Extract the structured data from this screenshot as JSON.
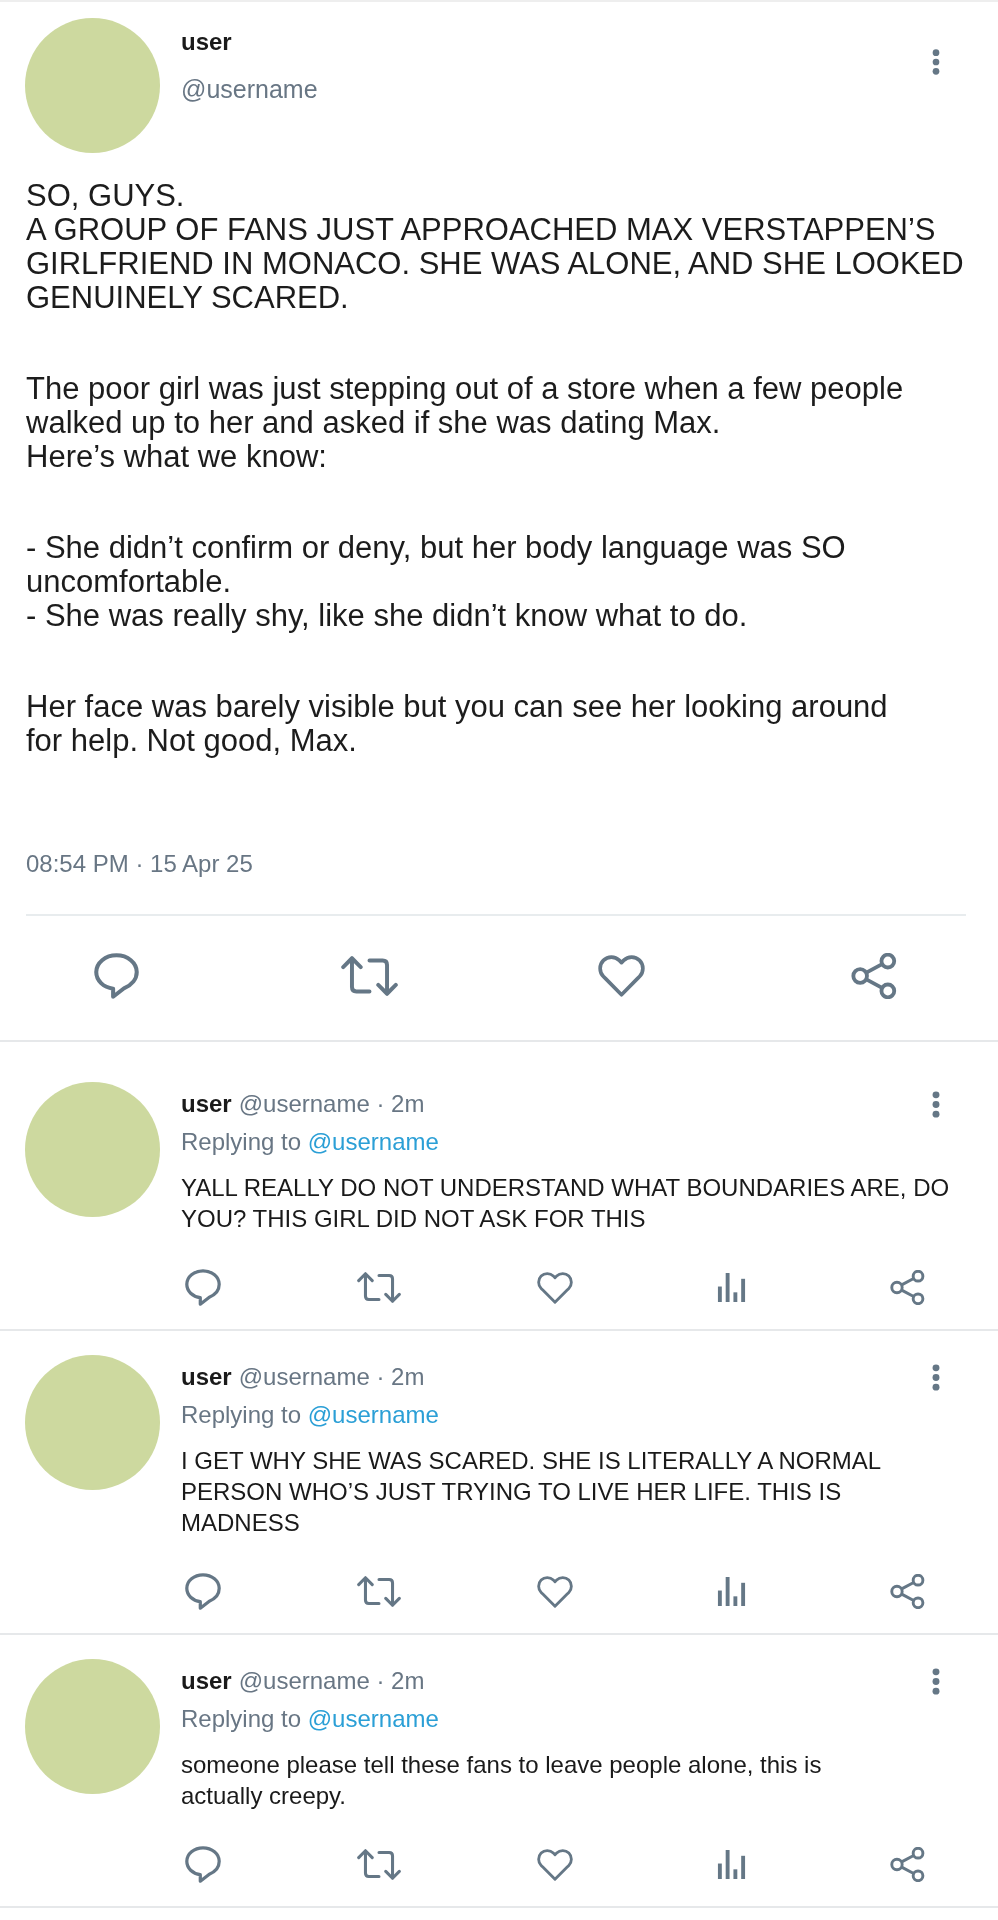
{
  "post": {
    "author": {
      "name": "user",
      "handle": "@username"
    },
    "paragraphs": [
      "SO, GUYS.\nA GROUP OF FANS JUST APPROACHED MAX VERSTAPPEN’S\nGIRLFRIEND IN MONACO. SHE WAS ALONE, AND SHE LOOKED\nGENUINELY SCARED.",
      "The poor girl was just stepping out of a store when a few people\nwalked up to her and asked if she was dating Max.\nHere’s what we know:",
      "- She didn’t confirm or deny, but her body language was SO\nuncomfortable.\n- She was really shy, like she didn’t know what to do.",
      "Her face was barely visible but you can see her looking around\nfor help. Not good, Max."
    ],
    "timestamp": "08:54 PM · 15 Apr 25",
    "actions": [
      {
        "kind": "comment"
      },
      {
        "kind": "repost"
      },
      {
        "kind": "like"
      },
      {
        "kind": "share"
      }
    ]
  },
  "replies": [
    {
      "name": "user",
      "byline": "@username · 2m",
      "replying_label": "Replying to",
      "replying_to": "@username",
      "text": "YALL REALLY DO NOT UNDERSTAND WHAT BOUNDARIES ARE, DO\nYOU? THIS GIRL DID NOT ASK FOR THIS",
      "actions": [
        {
          "kind": "comment"
        },
        {
          "kind": "repost"
        },
        {
          "kind": "like"
        },
        {
          "kind": "stats"
        },
        {
          "kind": "share"
        }
      ]
    },
    {
      "name": "user",
      "byline": "@username · 2m",
      "replying_label": "Replying to",
      "replying_to": "@username",
      "text": "I GET WHY SHE WAS SCARED. SHE IS LITERALLY A NORMAL\nPERSON WHO’S JUST TRYING TO LIVE HER LIFE. THIS IS\nMADNESS",
      "actions": [
        {
          "kind": "comment"
        },
        {
          "kind": "repost"
        },
        {
          "kind": "like"
        },
        {
          "kind": "stats"
        },
        {
          "kind": "share"
        }
      ]
    },
    {
      "name": "user",
      "byline": "@username · 2m",
      "replying_label": "Replying to",
      "replying_to": "@username",
      "text": "someone please tell these fans to leave people alone, this is\nactually creepy.",
      "actions": [
        {
          "kind": "comment"
        },
        {
          "kind": "repost"
        },
        {
          "kind": "like"
        },
        {
          "kind": "stats"
        },
        {
          "kind": "share"
        }
      ]
    }
  ]
}
